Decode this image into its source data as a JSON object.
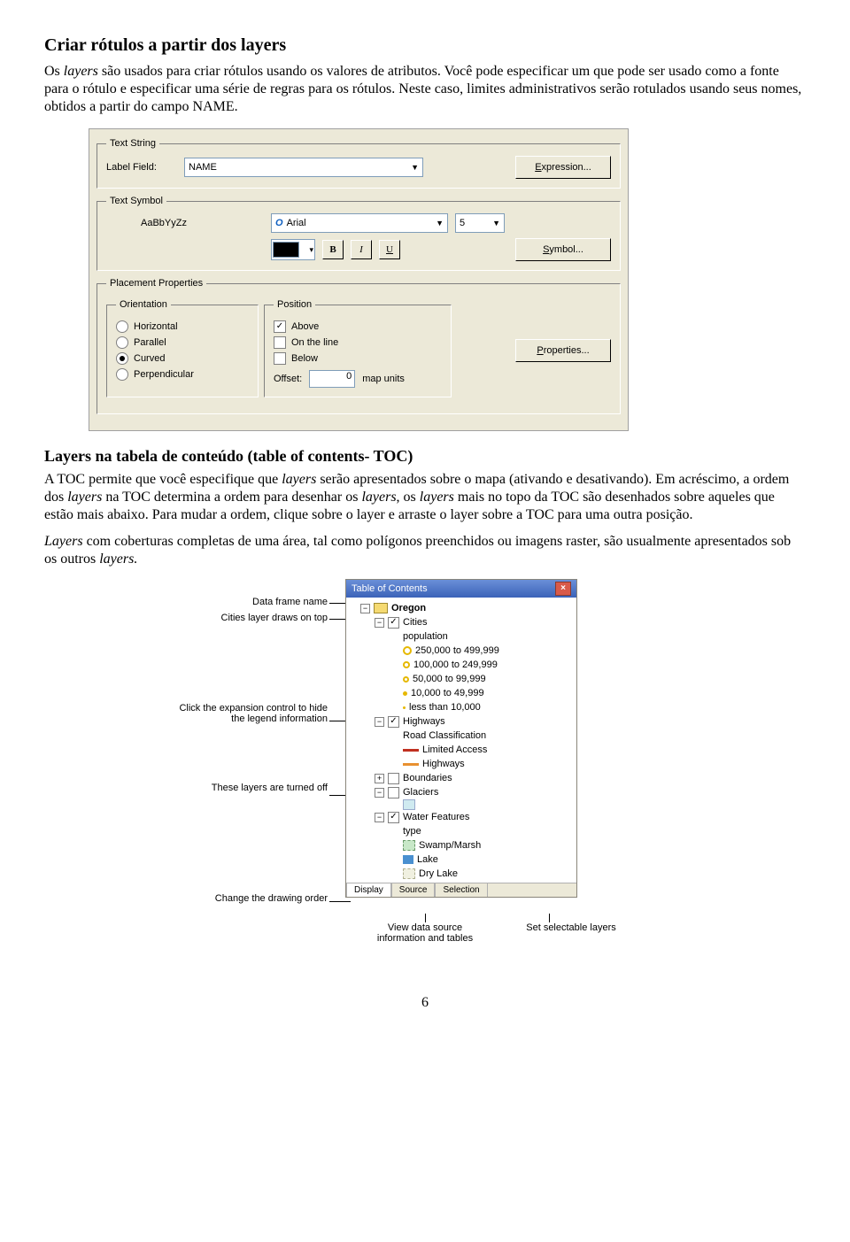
{
  "h1": "Criar rótulos a partir dos layers",
  "p1a": "Os ",
  "p1b": "layers",
  "p1c": " são usados para criar rótulos usando os valores de atributos. Você pode especificar um que pode ser usado como a fonte para o rótulo e especificar uma série de regras para os rótulos. Neste caso, limites administrativos serão rotulados usando seus nomes, obtidos a partir do campo NAME.",
  "dlg": {
    "text_string_legend": "Text String",
    "label_field": "Label Field:",
    "label_field_value": "NAME",
    "expression": "Expression...",
    "text_symbol_legend": "Text Symbol",
    "sample_text": "AaBbYyZz",
    "font_value": "Arial",
    "font_size": "5",
    "bold": "B",
    "italic": "I",
    "underline": "U",
    "symbol_btn": "Symbol...",
    "placement_legend": "Placement Properties",
    "orientation_legend": "Orientation",
    "orient": {
      "horizontal": "Horizontal",
      "parallel": "Parallel",
      "curved": "Curved",
      "perpendicular": "Perpendicular"
    },
    "position_legend": "Position",
    "pos": {
      "above": "Above",
      "online": "On the line",
      "below": "Below"
    },
    "offset_label": "Offset:",
    "offset_value": "0",
    "offset_units": "map units",
    "properties_btn": "Properties..."
  },
  "h2": "Layers na tabela de conteúdo (table of contents- TOC)",
  "p2a": "A TOC permite que você especifique que ",
  "p2b": "layers",
  "p2c": " serão apresentados sobre o mapa (ativando e desativando). Em acréscimo, a ordem dos ",
  "p2d": "layers",
  "p2e": " na TOC determina a ordem para desenhar os ",
  "p2f": "layers",
  "p2g": ", os ",
  "p2h": "layers",
  "p2i": " mais no topo da TOC são desenhados sobre aqueles que estão mais abaixo. Para mudar a ordem, clique sobre o layer e arraste o layer sobre a TOC para uma outra posição.",
  "p3a": "Layers",
  "p3b": " com coberturas completas de uma área, tal como polígonos preenchidos ou imagens raster, são usualmente apresentados sob os outros ",
  "p3c": "layers.",
  "toc": {
    "title": "Table of Contents",
    "annot": {
      "dataframe": "Data frame name",
      "cities": "Cities layer draws on top",
      "expand": "Click the expansion control to hide the legend information",
      "off": "These layers are turned off",
      "order": "Change the drawing order",
      "viewsrc": "View data source information and tables",
      "selectable": "Set selectable layers"
    },
    "tree": {
      "oregon": "Oregon",
      "cities": "Cities",
      "cities_field": "population",
      "c1": "250,000 to 499,999",
      "c2": "100,000 to 249,999",
      "c3": "50,000 to 99,999",
      "c4": "10,000 to 49,999",
      "c5": "less than 10,000",
      "highways": "Highways",
      "highways_field": "Road Classification",
      "h1": "Limited Access",
      "h2": "Highways",
      "boundaries": "Boundaries",
      "glaciers": "Glaciers",
      "water": "Water Features",
      "water_field": "type",
      "w1": "Swamp/Marsh",
      "w2": "Lake",
      "w3": "Dry Lake"
    },
    "tabs": {
      "display": "Display",
      "source": "Source",
      "selection": "Selection"
    }
  },
  "page": "6"
}
